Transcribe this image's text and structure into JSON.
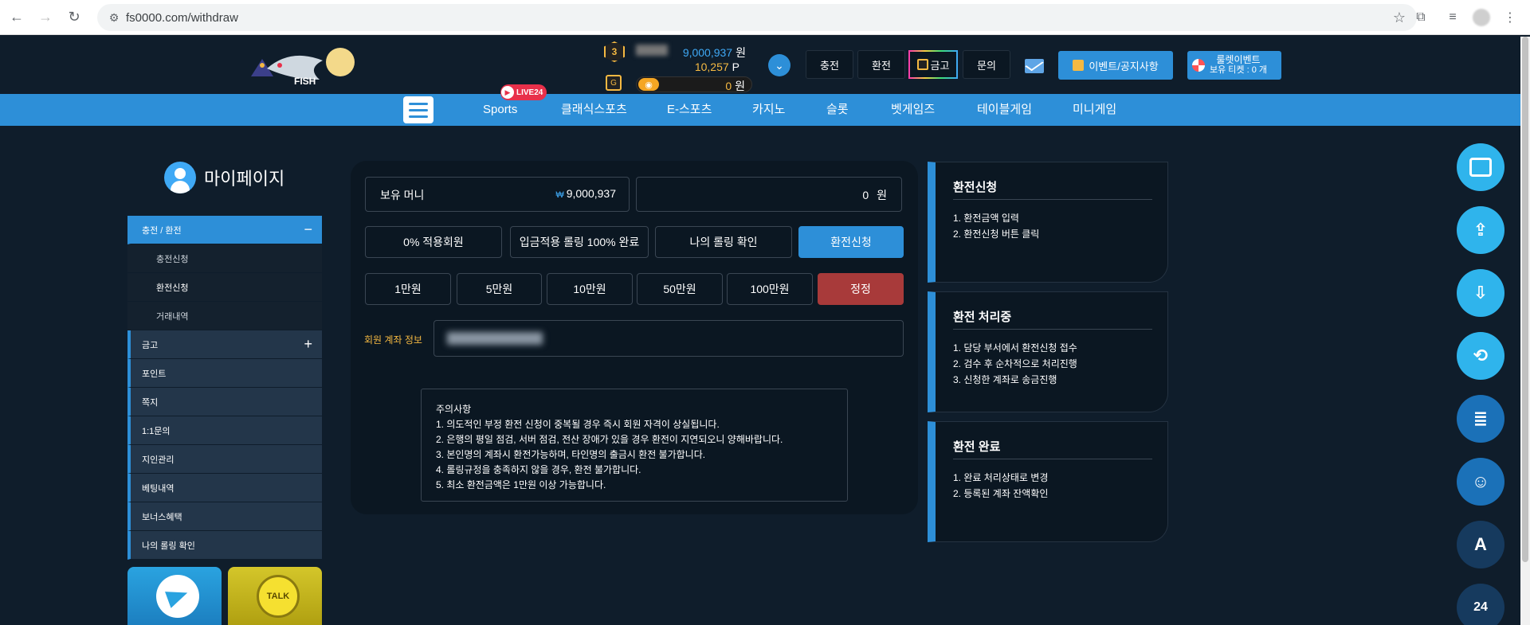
{
  "browser": {
    "url": "fs0000.com/withdraw"
  },
  "header": {
    "logo_text": "FISH",
    "level": "3",
    "money": "9,000,937",
    "money_unit": "원",
    "points": "10,257",
    "points_unit": "P",
    "vault_value": "0",
    "vault_unit": "원",
    "buttons": {
      "deposit": "충전",
      "withdraw": "환전",
      "vault": "금고",
      "inquiry": "문의",
      "event": "이벤트/공지사항",
      "roulette_line1": "룰렛이벤트",
      "roulette_line2": "보유 티켓 : 0 개"
    }
  },
  "nav": {
    "live_badge": "LIVE24",
    "items": [
      "Sports",
      "클래식스포츠",
      "E-스포츠",
      "카지노",
      "슬롯",
      "벳게임즈",
      "테이블게임",
      "미니게임"
    ]
  },
  "sidebar": {
    "title": "마이페이지",
    "items": [
      {
        "label": "충전 / 환전",
        "type": "main",
        "active": true,
        "sign": "−"
      },
      {
        "label": "충전신청",
        "type": "sub"
      },
      {
        "label": "환전신청",
        "type": "sub"
      },
      {
        "label": "거래내역",
        "type": "sub"
      },
      {
        "label": "금고",
        "type": "main",
        "sign": "+"
      },
      {
        "label": "포인트",
        "type": "main"
      },
      {
        "label": "쪽지",
        "type": "main"
      },
      {
        "label": "1:1문의",
        "type": "main"
      },
      {
        "label": "지인관리",
        "type": "main"
      },
      {
        "label": "베팅내역",
        "type": "main"
      },
      {
        "label": "보너스혜택",
        "type": "main"
      },
      {
        "label": "나의 롤링 확인",
        "type": "main"
      }
    ],
    "promo_kakao_text": "TALK"
  },
  "withdraw": {
    "balance_label": "보유 머니",
    "balance_currency": "₩",
    "balance_value": "9,000,937",
    "amount_value": "0",
    "amount_unit": "원",
    "info_buttons": [
      "0% 적용회원",
      "입금적용 롤링 100% 완료",
      "나의 롤링 확인"
    ],
    "submit_label": "환전신청",
    "amount_buttons": [
      "1만원",
      "5만원",
      "10만원",
      "50만원",
      "100만원"
    ],
    "reset_label": "정정",
    "account_label": "회원 계좌 정보",
    "notice": [
      "주의사항",
      "1. 의도적인 부정 환전 신청이 중복될 경우 즉시 회원 자격이 상실됩니다.",
      "2. 은행의 평일 점검, 서버 점검, 전산 장애가 있을 경우 환전이 지연되오니 양해바랍니다.",
      "3. 본인명의 계좌시 환전가능하며, 타인명의 출금시 환전 불가합니다.",
      "4. 롤링규정을 충족하지 않을 경우, 환전 불가합니다.",
      "5. 최소 환전금액은 1만원 이상 가능합니다."
    ]
  },
  "steps": [
    {
      "title": "환전신청",
      "lines": [
        "1. 환전금액 입력",
        "2. 환전신청 버튼 클릭"
      ]
    },
    {
      "title": "환전 처리중",
      "lines": [
        "1. 담당 부서에서 환전신청 접수",
        "2. 검수 후 순차적으로 처리진행",
        "3. 신청한 계좌로 송금진행"
      ]
    },
    {
      "title": "환전 완료",
      "lines": [
        "1. 완료 처리상태로 변경",
        "2. 등록된 계좌 잔액확인"
      ]
    }
  ],
  "floating": [
    "vault-icon",
    "deposit-icon",
    "withdraw-icon",
    "point-exchange-icon",
    "document-icon",
    "user-manage-icon",
    "translate-icon",
    "support-24-icon"
  ],
  "colors": {
    "accent": "#2d8fd8",
    "bg": "#0f1d2b",
    "panel": "#0b1722",
    "gold": "#f5b942",
    "reset": "#a83a3a"
  }
}
